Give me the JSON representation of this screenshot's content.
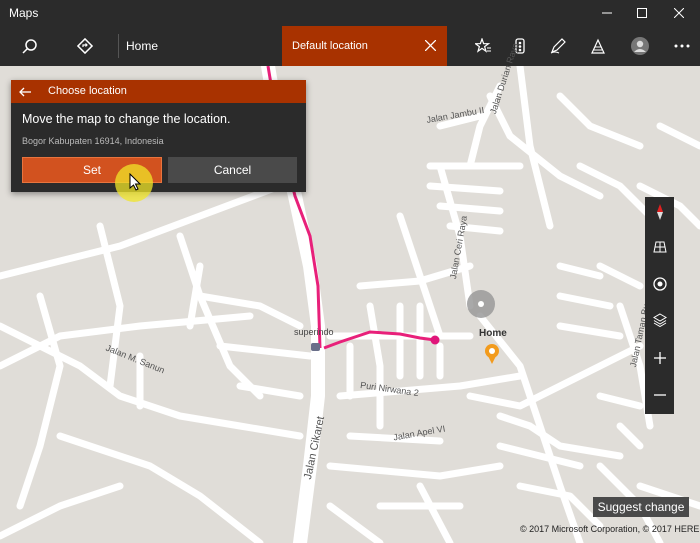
{
  "window": {
    "title": "Maps"
  },
  "toolbar": {
    "home_label": "Home",
    "default_location_tab": "Default location"
  },
  "dialog": {
    "title": "Choose location",
    "message": "Move the map to change the location.",
    "address": "Bogor Kabupaten 16914, Indonesia",
    "set_label": "Set",
    "cancel_label": "Cancel"
  },
  "map": {
    "labels": {
      "jalan_jambu": "Jalan Jambu II",
      "jalan_durian": "Jalan Durian Raya",
      "jalan_ceri": "Jalan Ceri Raya",
      "jalan_taman": "Jalan Taman Bu",
      "jalan_sanun": "Jalan M. Sanun",
      "jalan_cikaret": "Jalan Cikaret",
      "puri_nirwana": "Puri Nirwana 2",
      "jalan_apel": "Jalan Apel VI",
      "superindo": "superindo",
      "home": "Home"
    },
    "route_color": "#e8207a",
    "accent_color": "#a83200"
  },
  "controls": {
    "suggest_change": "Suggest change"
  },
  "footer": {
    "copyright": "© 2017 Microsoft Corporation, © 2017 HERE"
  }
}
